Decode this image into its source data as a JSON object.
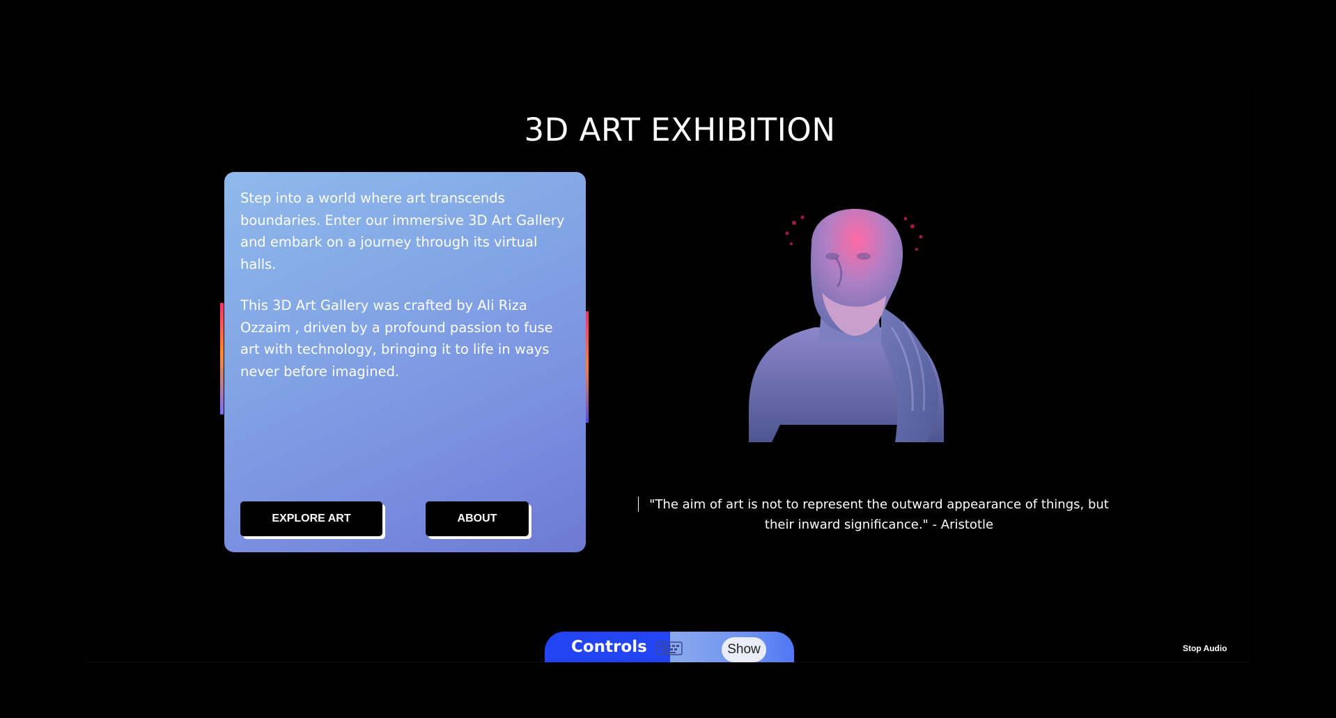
{
  "page": {
    "title": "3D ART EXHIBITION"
  },
  "intro_card": {
    "paragraphs": [
      "Step into a world where art transcends boundaries. Enter our immersive 3D Art Gallery and embark on a journey through its virtual halls.",
      "This 3D Art Gallery was crafted by Ali Riza Ozzaim , driven by a profound passion to fuse art with technology, bringing it to life in ways never before imagined."
    ],
    "buttons": {
      "explore": "EXPLORE ART",
      "about": "ABOUT"
    }
  },
  "quote": {
    "text": "\"The aim of art is not to represent the outward appearance of things, but their inward significance.\" - Aristotle"
  },
  "controls": {
    "label": "Controls",
    "icon": "keyboard-icon",
    "show_label": "Show"
  },
  "audio": {
    "stop_label": "Stop Audio"
  },
  "colors": {
    "background": "#000000",
    "card_gradient_start": "#8fb9ea",
    "card_gradient_end": "#6e79d2",
    "controls_accent": "#2244f2"
  }
}
